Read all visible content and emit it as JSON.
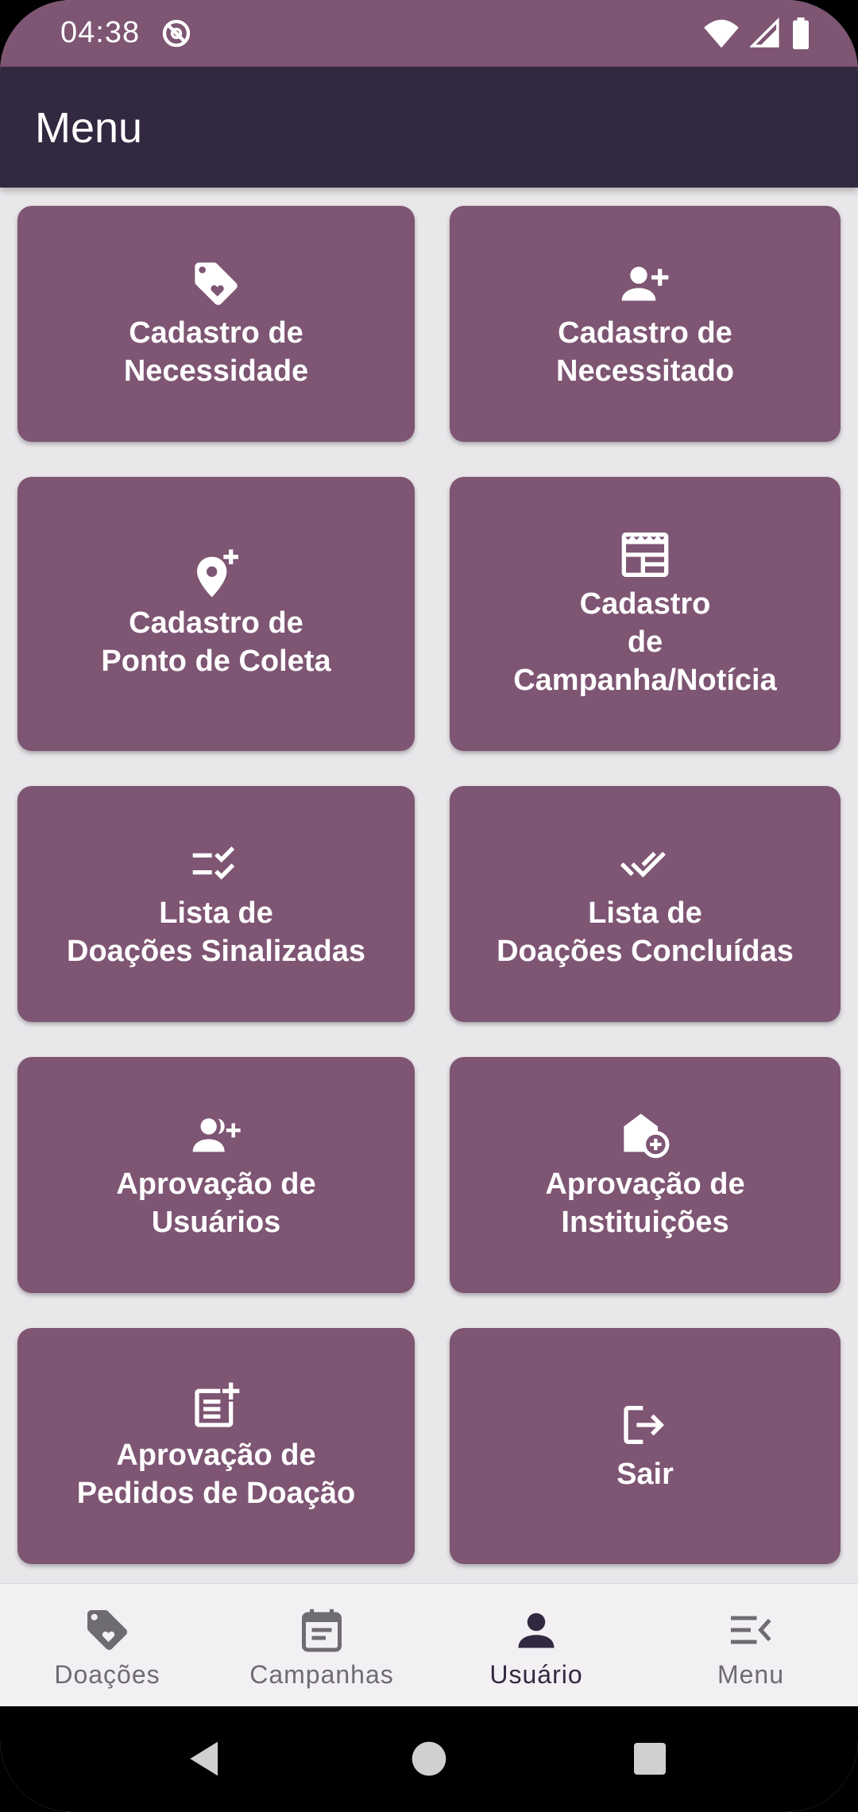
{
  "status_bar": {
    "time": "04:38"
  },
  "app_bar": {
    "title": "Menu"
  },
  "cards": [
    {
      "label": "Cadastro de\nNecessidade",
      "icon": "tag-heart-icon"
    },
    {
      "label": "Cadastro de\nNecessitado",
      "icon": "person-add-icon"
    },
    {
      "label": "Cadastro de\nPonto de Coleta",
      "icon": "location-add-icon"
    },
    {
      "label": "Cadastro\nde\nCampanha/Notícia",
      "icon": "newspaper-icon"
    },
    {
      "label": "Lista de\nDoações Sinalizadas",
      "icon": "checklist-icon"
    },
    {
      "label": "Lista de\nDoações Concluídas",
      "icon": "double-check-icon"
    },
    {
      "label": "Aprovação de\nUsuários",
      "icon": "group-add-icon"
    },
    {
      "label": "Aprovação de\nInstituições",
      "icon": "add-home-icon"
    },
    {
      "label": "Aprovação de\nPedidos de Doação",
      "icon": "post-add-icon"
    },
    {
      "label": "Sair",
      "icon": "logout-icon"
    }
  ],
  "bottom_nav": {
    "items": [
      {
        "label": "Doações",
        "icon": "tag-heart-icon",
        "active": false
      },
      {
        "label": "Campanhas",
        "icon": "event-note-icon",
        "active": false
      },
      {
        "label": "Usuário",
        "icon": "person-icon",
        "active": true
      },
      {
        "label": "Menu",
        "icon": "menu-open-icon",
        "active": false
      }
    ]
  },
  "colors": {
    "card": "#7e5573",
    "app_bar": "#322840",
    "status_bar": "#7e5573",
    "background": "#e9e7ea"
  }
}
